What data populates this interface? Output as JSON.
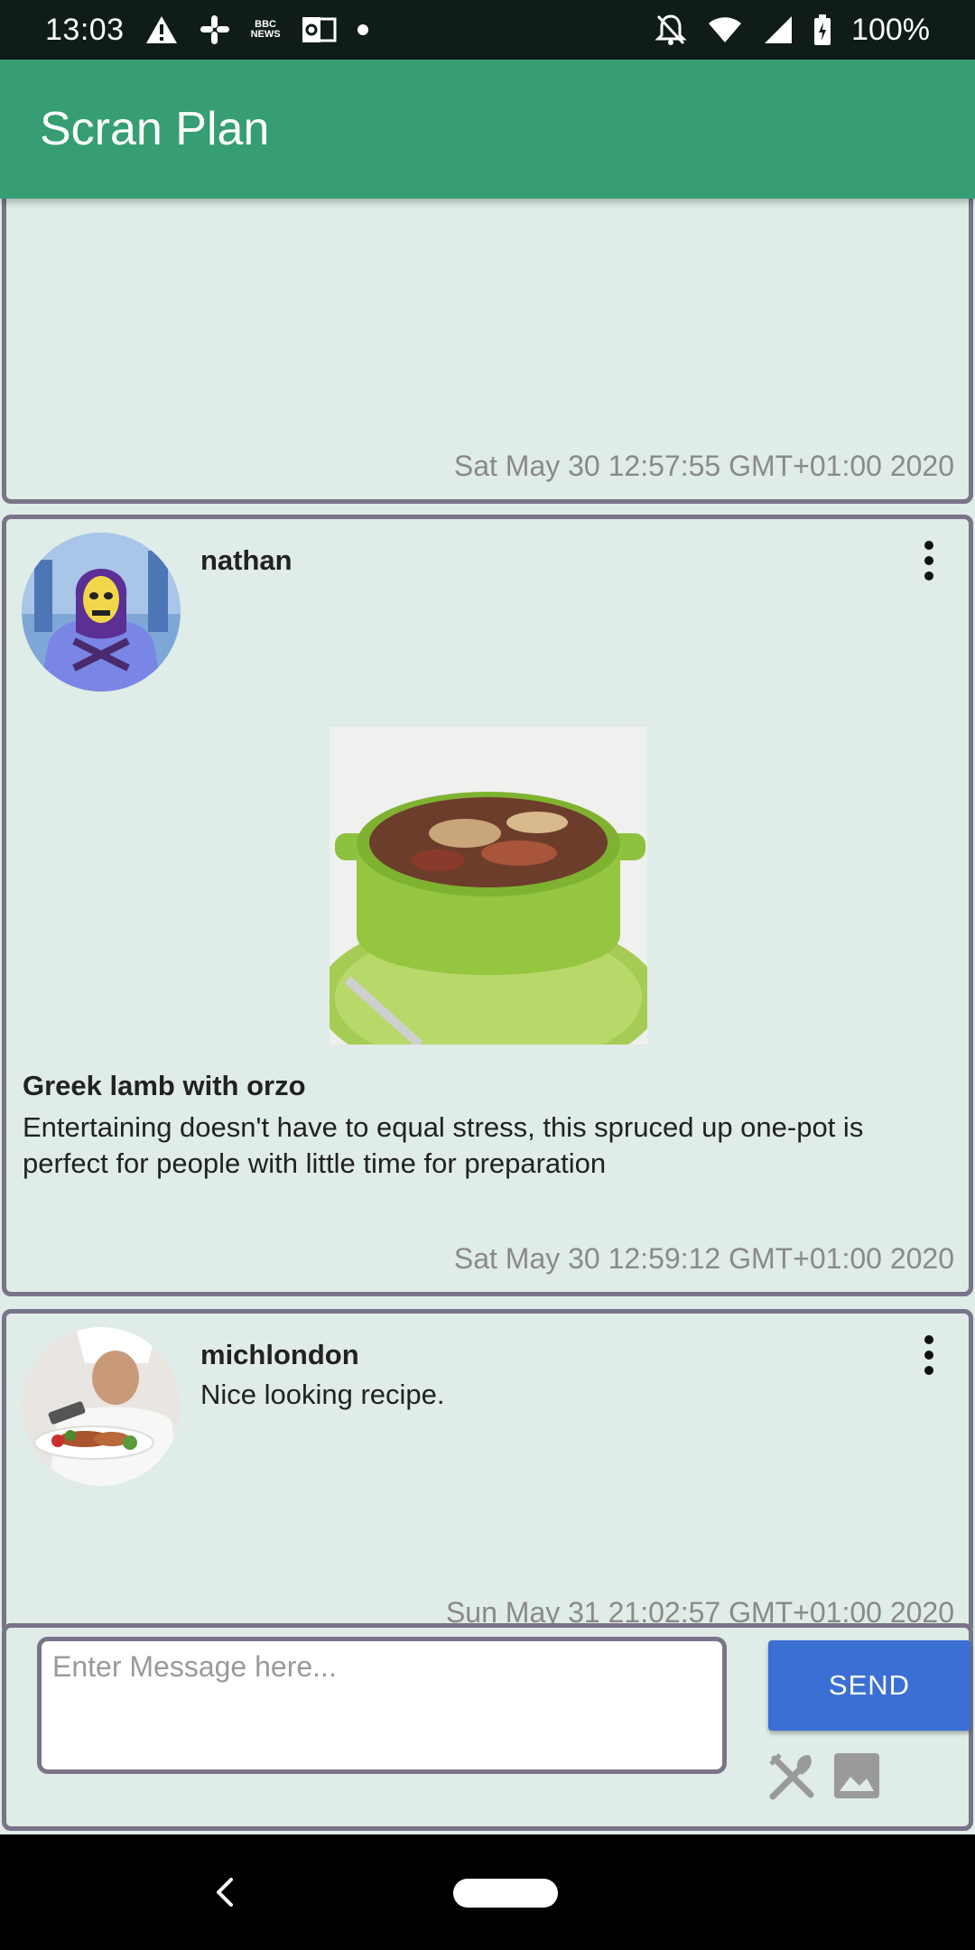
{
  "status_bar": {
    "time": "13:03",
    "battery": "100%",
    "notification_icons": [
      "alert-icon",
      "slack-icon",
      "bbc-news-icon",
      "outlook-icon",
      "dot-icon"
    ],
    "news_label_top": "BBC",
    "news_label_bottom": "NEWS",
    "system_icons": [
      "do-not-disturb-icon",
      "wifi-icon",
      "signal-icon",
      "battery-icon"
    ]
  },
  "app_bar": {
    "title": "Scran Plan",
    "color": "#369e72"
  },
  "messages": [
    {
      "timestamp": "Sat May 30 12:57:55 GMT+01:00 2020"
    },
    {
      "username": "nathan",
      "avatar": "skeletor-avatar",
      "recipe_title": "Greek lamb with orzo",
      "recipe_description": "Entertaining doesn't have to equal stress, this spruced up one-pot is perfect for people with little time for preparation",
      "timestamp": "Sat May 30 12:59:12 GMT+01:00 2020"
    },
    {
      "username": "michlondon",
      "avatar": "chef-avatar",
      "text": "Nice looking recipe.",
      "timestamp": "Sun May 31 21:02:57 GMT+01:00 2020"
    }
  ],
  "composer": {
    "placeholder": "Enter Message here...",
    "value": "",
    "send_label": "SEND",
    "send_color": "#3b6fd4",
    "attach_icons": [
      "fork-knife-icon",
      "image-icon"
    ]
  },
  "nav_bar": {
    "icons": [
      "back-icon",
      "home-pill"
    ]
  }
}
